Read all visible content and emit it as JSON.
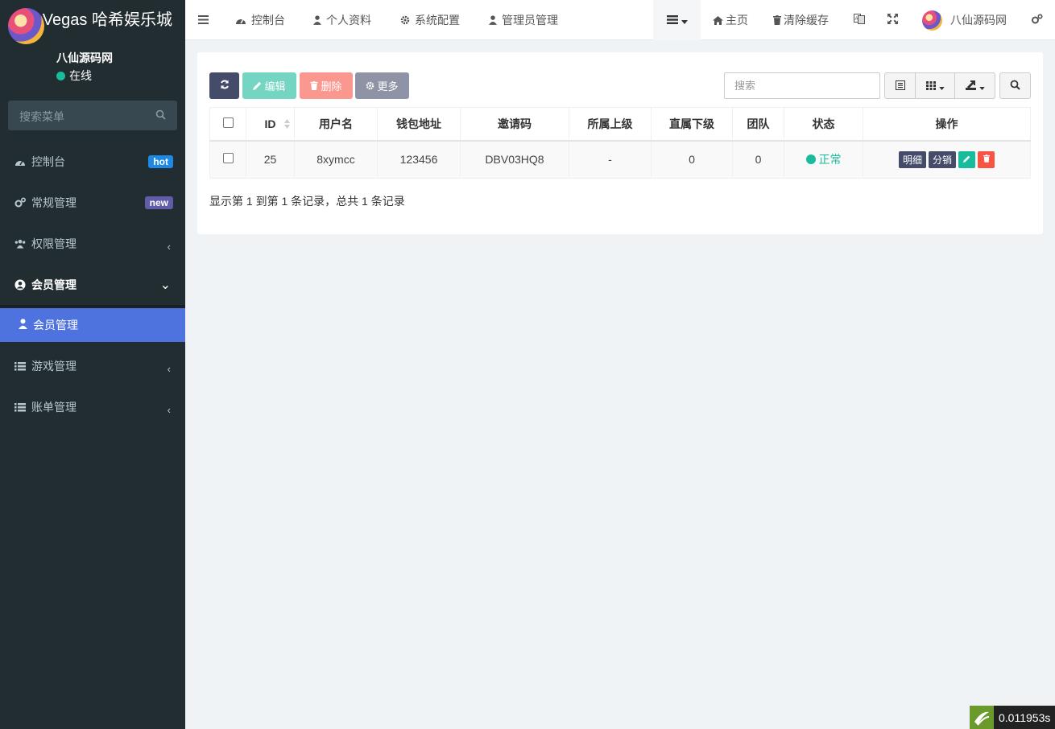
{
  "brand": {
    "title": "Las Vegas 哈希娱乐城"
  },
  "user": {
    "name": "八仙源码网",
    "status": "在线"
  },
  "sidebar": {
    "search_placeholder": "搜索菜单",
    "items": [
      {
        "label": "控制台",
        "icon": "dashboard-icon",
        "badge": "hot",
        "badge_color": "#1e88e5"
      },
      {
        "label": "常规管理",
        "icon": "cogs-icon",
        "badge": "new",
        "badge_color": "#605ca8"
      },
      {
        "label": "权限管理",
        "icon": "group-icon",
        "chevron": "‹"
      },
      {
        "label": "会员管理",
        "icon": "user-circle-icon",
        "chevron": "⌄"
      },
      {
        "label": "游戏管理",
        "icon": "list-icon",
        "chevron": "‹"
      },
      {
        "label": "账单管理",
        "icon": "list-icon",
        "chevron": "‹"
      }
    ],
    "sub_active": {
      "label": "会员管理",
      "icon": "user-icon"
    }
  },
  "navbar": {
    "items": [
      {
        "label": "控制台",
        "icon": "dashboard-icon"
      },
      {
        "label": "个人资料",
        "icon": "user-icon"
      },
      {
        "label": "系统配置",
        "icon": "gear-icon"
      },
      {
        "label": "管理员管理",
        "icon": "user-icon"
      }
    ],
    "right": {
      "home": "主页",
      "clear_cache": "清除缓存",
      "user": "八仙源码网"
    }
  },
  "toolbar": {
    "refresh": "",
    "edit": "编辑",
    "delete": "删除",
    "more": "更多",
    "search_placeholder": "搜索"
  },
  "table": {
    "headers": [
      "ID",
      "用户名",
      "钱包地址",
      "邀请码",
      "所属上级",
      "直属下级",
      "团队",
      "状态",
      "操作"
    ],
    "rows": [
      {
        "id": "25",
        "username": "8xymcc",
        "wallet": "123456",
        "invite": "DBV03HQ8",
        "parent": "-",
        "direct": "0",
        "team": "0",
        "status": "正常",
        "btn_detail": "明细",
        "btn_distribute": "分销"
      }
    ]
  },
  "pagination": {
    "text": "显示第 1 到第 1 条记录，总共 1 条记录"
  },
  "timer": {
    "value": "0.011953s"
  },
  "colors": {
    "sidebar_bg": "#222d32",
    "active": "#4e73df",
    "success": "#18bc9c",
    "danger": "#f75444"
  }
}
